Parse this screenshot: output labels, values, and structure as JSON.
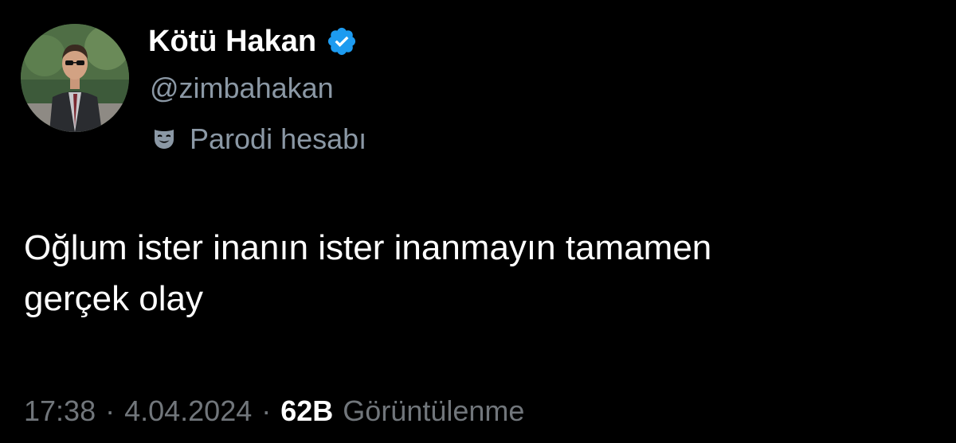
{
  "tweet": {
    "author": {
      "display_name": "Kötü Hakan",
      "handle": "@zimbahakan",
      "verified_icon": "verified-badge-icon",
      "verified_color": "#1d9bf0",
      "account_label_icon": "parody-mask-icon",
      "account_label": "Parodi hesabı"
    },
    "text": "Oğlum ister inanın ister inanmayın tamamen\ngerçek olay",
    "meta": {
      "time": "17:38",
      "separator": "·",
      "date": "4.04.2024",
      "views_count": "62B",
      "views_label": "Görüntülenme"
    }
  },
  "colors": {
    "background": "#000000",
    "primary_text": "#ffffff",
    "secondary_text": "#8b98a5"
  }
}
